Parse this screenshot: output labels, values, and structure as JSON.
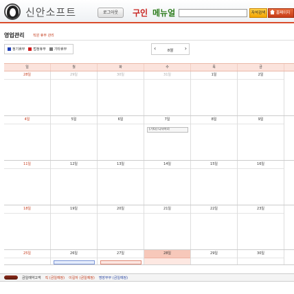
{
  "header": {
    "brand": "신안소프트",
    "logout_label": "로그아웃",
    "nav_job": "구인",
    "nav_menu": "메뉴얼",
    "search_placeholder": "",
    "search_button": "자석검색",
    "home_button": "홈페이지"
  },
  "page": {
    "title": "영업관리",
    "breadcrumb": "직원 휴무 관리"
  },
  "legend": {
    "items": [
      {
        "label": "정기휴무",
        "color": "#1f3fb5"
      },
      {
        "label": "법정휴무",
        "color": "#d01b1b"
      },
      {
        "label": "기타휴무",
        "color": "#777777"
      }
    ]
  },
  "month_nav": {
    "prev": "‹",
    "month": "8월",
    "next": "›"
  },
  "calendar": {
    "weekdays": [
      "일",
      "월",
      "화",
      "수",
      "목",
      "금"
    ],
    "weeks": [
      [
        "28일",
        "29일",
        "30일",
        "31일",
        "1일",
        "2일"
      ],
      [
        "4일",
        "5일",
        "6일",
        "7일",
        "8일",
        "9일"
      ],
      [
        "11일",
        "12일",
        "13일",
        "14일",
        "15일",
        "16일"
      ],
      [
        "18일",
        "19일",
        "20일",
        "21일",
        "22일",
        "23일"
      ],
      [
        "25일",
        "26일",
        "27일",
        "28일",
        "29일",
        "30일"
      ]
    ],
    "event_text": "[기타] 디자이너"
  },
  "footer": {
    "label": "금일예약고객",
    "schedules": [
      {
        "text": "직 (금일예정)",
        "color": "#c43a1a"
      },
      {
        "text": "이길자 (금일예정)",
        "color": "#c43a1a"
      },
      {
        "text": "명장부부 (금일예정)",
        "color": "#2d4aa5"
      }
    ]
  }
}
